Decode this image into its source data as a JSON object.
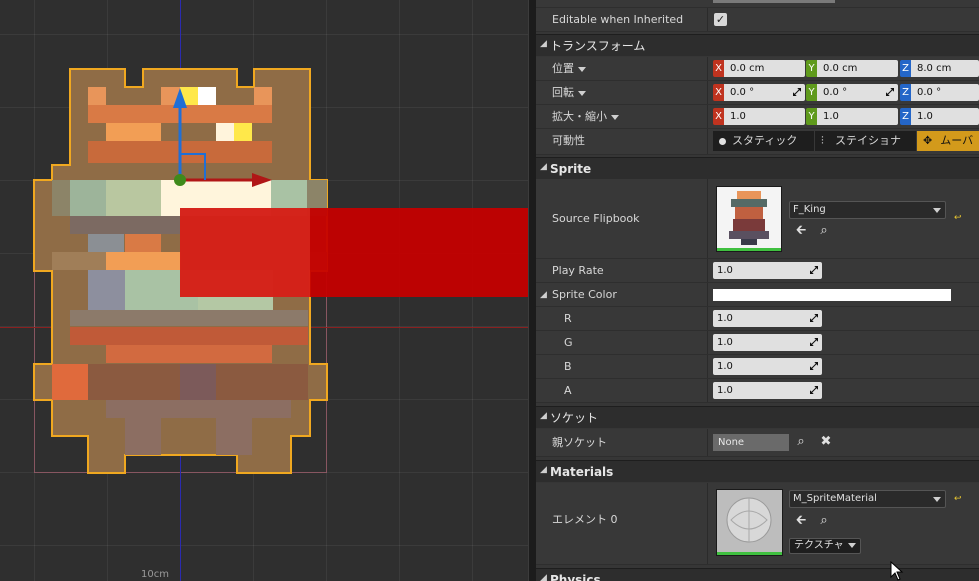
{
  "viewport": {
    "scale_label": "10cm",
    "colors": {
      "grid_blue_axis": "#2b2bb0",
      "grid_red_axis": "#8a2020",
      "selection": "#f0a820"
    }
  },
  "details": {
    "editable_when_inherited": {
      "label": "Editable when Inherited",
      "checked": true,
      "check_glyph": "✓"
    },
    "transform": {
      "title": "トランスフォーム",
      "location": {
        "label": "位置",
        "x": "0.0 cm",
        "y": "0.0 cm",
        "z": "8.0 cm"
      },
      "rotation": {
        "label": "回転",
        "x": "0.0 °",
        "y": "0.0 °",
        "z": "0.0 °"
      },
      "scale": {
        "label": "拡大・縮小",
        "x": "1.0",
        "y": "1.0",
        "z": "1.0"
      },
      "mobility": {
        "label": "可動性",
        "static": "スタティック",
        "stationary": "ステイショナ",
        "movable": "ムーバ"
      },
      "axis_letters": {
        "x": "X",
        "y": "Y",
        "z": "Z"
      }
    },
    "sprite": {
      "title": "Sprite",
      "source_flipbook": {
        "label": "Source Flipbook",
        "value": "F_King"
      },
      "play_rate": {
        "label": "Play Rate",
        "value": "1.0"
      },
      "sprite_color": {
        "label": "Sprite Color",
        "r_label": "R",
        "g_label": "G",
        "b_label": "B",
        "a_label": "A",
        "r": "1.0",
        "g": "1.0",
        "b": "1.0",
        "a": "1.0",
        "swatch": "#ffffff"
      }
    },
    "socket": {
      "title": "ソケット",
      "parent_socket": {
        "label": "親ソケット",
        "value": "None"
      }
    },
    "materials": {
      "title": "Materials",
      "element0": {
        "label": "エレメント 0",
        "value": "M_SpriteMaterial",
        "texture_button": "テクスチャ"
      }
    },
    "physics": {
      "title": "Physics"
    }
  }
}
